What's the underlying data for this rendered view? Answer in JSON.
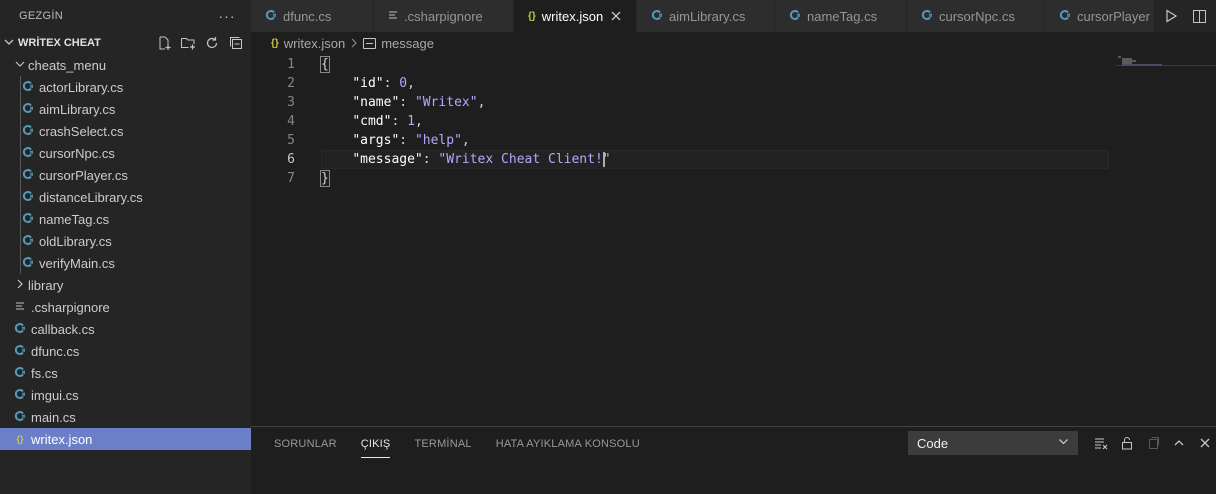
{
  "explorer": {
    "title": "GEZGİN",
    "more_label": "···",
    "section": "WRİTEX CHEAT",
    "tree": [
      {
        "label": "cheats_menu",
        "type": "folder",
        "open": true,
        "depth": 1
      },
      {
        "label": "actorLibrary.cs",
        "type": "cs",
        "depth": 2
      },
      {
        "label": "aimLibrary.cs",
        "type": "cs",
        "depth": 2
      },
      {
        "label": "crashSelect.cs",
        "type": "cs",
        "depth": 2
      },
      {
        "label": "cursorNpc.cs",
        "type": "cs",
        "depth": 2
      },
      {
        "label": "cursorPlayer.cs",
        "type": "cs",
        "depth": 2
      },
      {
        "label": "distanceLibrary.cs",
        "type": "cs",
        "depth": 2
      },
      {
        "label": "nameTag.cs",
        "type": "cs",
        "depth": 2
      },
      {
        "label": "oldLibrary.cs",
        "type": "cs",
        "depth": 2
      },
      {
        "label": "verifyMain.cs",
        "type": "cs",
        "depth": 2
      },
      {
        "label": "library",
        "type": "folder",
        "open": false,
        "depth": 1
      },
      {
        "label": ".csharpignore",
        "type": "ignore",
        "depth": 1
      },
      {
        "label": "callback.cs",
        "type": "cs",
        "depth": 1
      },
      {
        "label": "dfunc.cs",
        "type": "cs",
        "depth": 1
      },
      {
        "label": "fs.cs",
        "type": "cs",
        "depth": 1
      },
      {
        "label": "imgui.cs",
        "type": "cs",
        "depth": 1
      },
      {
        "label": "main.cs",
        "type": "cs",
        "depth": 1
      },
      {
        "label": "writex.json",
        "type": "json",
        "depth": 1,
        "selected": true
      }
    ]
  },
  "tabs": [
    {
      "label": "dfunc.cs",
      "type": "cs"
    },
    {
      "label": ".csharpignore",
      "type": "ignore"
    },
    {
      "label": "writex.json",
      "type": "json",
      "active": true
    },
    {
      "label": "aimLibrary.cs",
      "type": "cs"
    },
    {
      "label": "nameTag.cs",
      "type": "cs"
    },
    {
      "label": "cursorNpc.cs",
      "type": "cs"
    },
    {
      "label": "cursorPlayer",
      "type": "cs"
    }
  ],
  "breadcrumb": {
    "file": "writex.json",
    "symbol": "message"
  },
  "editor": {
    "current_line": 6,
    "lines": [
      {
        "n": "1",
        "tokens": [
          {
            "t": "{",
            "c": "brace"
          }
        ]
      },
      {
        "n": "2",
        "tokens": [
          {
            "t": "    ",
            "c": "ws"
          },
          {
            "t": "\"id\"",
            "c": "key"
          },
          {
            "t": ": ",
            "c": "punc"
          },
          {
            "t": "0",
            "c": "num"
          },
          {
            "t": ",",
            "c": "punc"
          }
        ]
      },
      {
        "n": "3",
        "tokens": [
          {
            "t": "    ",
            "c": "ws"
          },
          {
            "t": "\"name\"",
            "c": "key"
          },
          {
            "t": ": ",
            "c": "punc"
          },
          {
            "t": "\"Writex\"",
            "c": "str"
          },
          {
            "t": ",",
            "c": "punc"
          }
        ]
      },
      {
        "n": "4",
        "tokens": [
          {
            "t": "    ",
            "c": "ws"
          },
          {
            "t": "\"cmd\"",
            "c": "key"
          },
          {
            "t": ": ",
            "c": "punc"
          },
          {
            "t": "1",
            "c": "num"
          },
          {
            "t": ",",
            "c": "punc"
          }
        ]
      },
      {
        "n": "5",
        "tokens": [
          {
            "t": "    ",
            "c": "ws"
          },
          {
            "t": "\"args\"",
            "c": "key"
          },
          {
            "t": ": ",
            "c": "punc"
          },
          {
            "t": "\"help\"",
            "c": "str"
          },
          {
            "t": ",",
            "c": "punc"
          }
        ]
      },
      {
        "n": "6",
        "tokens": [
          {
            "t": "    ",
            "c": "ws"
          },
          {
            "t": "\"message\"",
            "c": "key"
          },
          {
            "t": ": ",
            "c": "punc"
          },
          {
            "t": "\"Writex Cheat Client!",
            "c": "str"
          },
          {
            "t": "",
            "c": "caret"
          },
          {
            "t": "\"",
            "c": "str"
          }
        ]
      },
      {
        "n": "7",
        "tokens": [
          {
            "t": "}",
            "c": "brace"
          }
        ]
      }
    ]
  },
  "panel": {
    "tabs": [
      {
        "label": "SORUNLAR"
      },
      {
        "label": "ÇIKIŞ",
        "active": true
      },
      {
        "label": "TERMİNAL"
      },
      {
        "label": "HATA AYIKLAMA KONSOLU"
      }
    ],
    "output_channel": "Code"
  }
}
